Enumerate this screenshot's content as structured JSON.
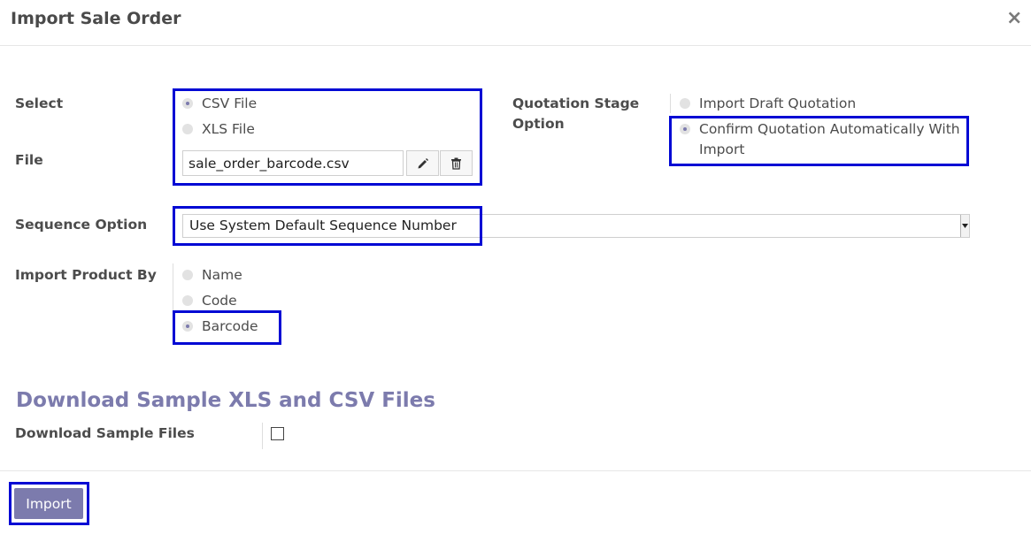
{
  "dialog": {
    "title": "Import Sale Order",
    "close_symbol": "×"
  },
  "form": {
    "select_label": "Select",
    "file_type_options": [
      {
        "label": "CSV File",
        "checked": true
      },
      {
        "label": "XLS File",
        "checked": false
      }
    ],
    "file_label": "File",
    "file_value": "sale_order_barcode.csv",
    "quotation_stage_label": "Quotation Stage Option",
    "quotation_stage_options": [
      {
        "label": "Import Draft Quotation",
        "checked": false
      },
      {
        "label": "Confirm Quotation Automatically With Import",
        "checked": true
      }
    ],
    "sequence_label": "Sequence Option",
    "sequence_value": "Use System Default Sequence Number",
    "import_product_label": "Import Product By",
    "import_product_options": [
      {
        "label": "Name",
        "checked": false
      },
      {
        "label": "Code",
        "checked": false
      },
      {
        "label": "Barcode",
        "checked": true
      }
    ]
  },
  "download": {
    "section_title": "Download Sample XLS and CSV Files",
    "checkbox_label": "Download Sample Files",
    "checked": false
  },
  "footer": {
    "import_label": "Import"
  },
  "colors": {
    "accent": "#7c7bad",
    "highlight": "#0008d4"
  }
}
